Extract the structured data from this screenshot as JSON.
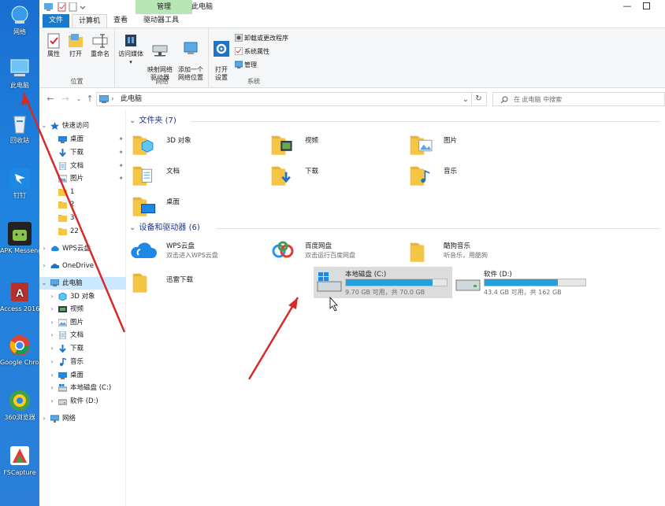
{
  "desktop": {
    "icons": [
      {
        "label": "网络",
        "icon": "network-icon"
      },
      {
        "label": "此电脑",
        "icon": "this-pc-icon"
      },
      {
        "label": "回收站",
        "icon": "recycle-bin-icon"
      },
      {
        "label": "钉钉",
        "icon": "dingtalk-icon"
      },
      {
        "label": "APK Messenger",
        "icon": "apk-messenger-icon"
      },
      {
        "label": "Access 2016",
        "icon": "access-icon"
      },
      {
        "label": "Google Chrome",
        "icon": "chrome-icon"
      },
      {
        "label": "360浏览器",
        "icon": "browser-360-icon"
      },
      {
        "label": "FSCapture",
        "icon": "fscapture-icon"
      }
    ]
  },
  "window": {
    "title": "此电脑",
    "manage_band": "管理",
    "tabs": [
      "文件",
      "计算机",
      "查看",
      "驱动器工具"
    ],
    "ribbon": {
      "location_group": {
        "label": "位置",
        "buttons": [
          "属性",
          "打开",
          "重命名"
        ]
      },
      "network_group": {
        "label": "网络",
        "buttons": [
          "访问媒体",
          "映射网络\n驱动器",
          "添加一个\n网络位置"
        ]
      },
      "system_group": {
        "label": "系统",
        "open_settings": "打开\n设置",
        "small": [
          "卸载或更改程序",
          "系统属性",
          "管理"
        ]
      }
    },
    "address": {
      "path": "此电脑",
      "search_placeholder": "在 此电脑 中搜索"
    }
  },
  "navpane": {
    "items": [
      {
        "label": "快速访问",
        "level": 0,
        "expanded": true,
        "icon": "star-icon"
      },
      {
        "label": "桌面",
        "level": 1,
        "pinned": true,
        "icon": "desktop-folder-icon"
      },
      {
        "label": "下载",
        "level": 1,
        "pinned": true,
        "icon": "download-arrow-icon"
      },
      {
        "label": "文档",
        "level": 1,
        "pinned": true,
        "icon": "document-icon"
      },
      {
        "label": "图片",
        "level": 1,
        "pinned": true,
        "icon": "picture-icon"
      },
      {
        "label": "1",
        "level": 1,
        "icon": "folder-icon"
      },
      {
        "label": "2",
        "level": 1,
        "icon": "folder-icon"
      },
      {
        "label": "3",
        "level": 1,
        "icon": "folder-icon"
      },
      {
        "label": "22",
        "level": 1,
        "icon": "folder-icon"
      },
      {
        "label": "WPS云盘",
        "level": 0,
        "icon": "wps-cloud-icon"
      },
      {
        "label": "OneDrive",
        "level": 0,
        "icon": "onedrive-icon"
      },
      {
        "label": "此电脑",
        "level": 0,
        "expanded": true,
        "selected": true,
        "icon": "this-pc-icon"
      },
      {
        "label": "3D 对象",
        "level": 1,
        "icon": "3d-objects-icon"
      },
      {
        "label": "视频",
        "level": 1,
        "icon": "video-icon"
      },
      {
        "label": "图片",
        "level": 1,
        "icon": "picture-icon"
      },
      {
        "label": "文档",
        "level": 1,
        "icon": "document-icon"
      },
      {
        "label": "下载",
        "level": 1,
        "icon": "download-arrow-icon"
      },
      {
        "label": "音乐",
        "level": 1,
        "icon": "music-icon"
      },
      {
        "label": "桌面",
        "level": 1,
        "icon": "desktop-folder-icon"
      },
      {
        "label": "本地磁盘 (C:)",
        "level": 1,
        "icon": "drive-c-icon"
      },
      {
        "label": "软件 (D:)",
        "level": 1,
        "icon": "drive-icon"
      },
      {
        "label": "网络",
        "level": 0,
        "icon": "network-icon"
      }
    ]
  },
  "content": {
    "folders_header": "文件夹 (7)",
    "folders": [
      {
        "label": "3D 对象",
        "icon": "3d-objects-folder-icon"
      },
      {
        "label": "视频",
        "icon": "video-folder-icon"
      },
      {
        "label": "图片",
        "icon": "pictures-folder-icon"
      },
      {
        "label": "文档",
        "icon": "documents-folder-icon"
      },
      {
        "label": "下载",
        "icon": "downloads-folder-icon"
      },
      {
        "label": "音乐",
        "icon": "music-folder-icon"
      },
      {
        "label": "桌面",
        "icon": "desktop-folder-icon"
      }
    ],
    "devices_header": "设备和驱动器 (6)",
    "devices": [
      {
        "label": "WPS云盘",
        "sub": "双击进入WPS云盘",
        "icon": "wps-cloud-icon"
      },
      {
        "label": "百度网盘",
        "sub": "双击运行百度网盘",
        "icon": "baidu-netdisk-icon"
      },
      {
        "label": "酷狗音乐",
        "sub": "听音乐，用酷狗",
        "icon": "kugou-folder-icon"
      },
      {
        "label": "迅雷下载",
        "sub": "",
        "icon": "xunlei-folder-icon"
      }
    ],
    "drives": [
      {
        "label": "本地磁盘 (C:)",
        "sub": "9.70 GB 可用，共 70.0 GB",
        "used_fraction": 0.86,
        "icon": "drive-c-icon",
        "hover": true
      },
      {
        "label": "软件 (D:)",
        "sub": "43.4 GB 可用，共 162 GB",
        "used_fraction": 0.73,
        "icon": "drive-d-icon",
        "hover": false
      }
    ]
  },
  "colors": {
    "accent": "#1979ca",
    "manage_band": "#b7e5b4",
    "selection": "#cce8ff",
    "drive_fill": "#26a0da",
    "annotation_arrow": "#d62a2a"
  }
}
